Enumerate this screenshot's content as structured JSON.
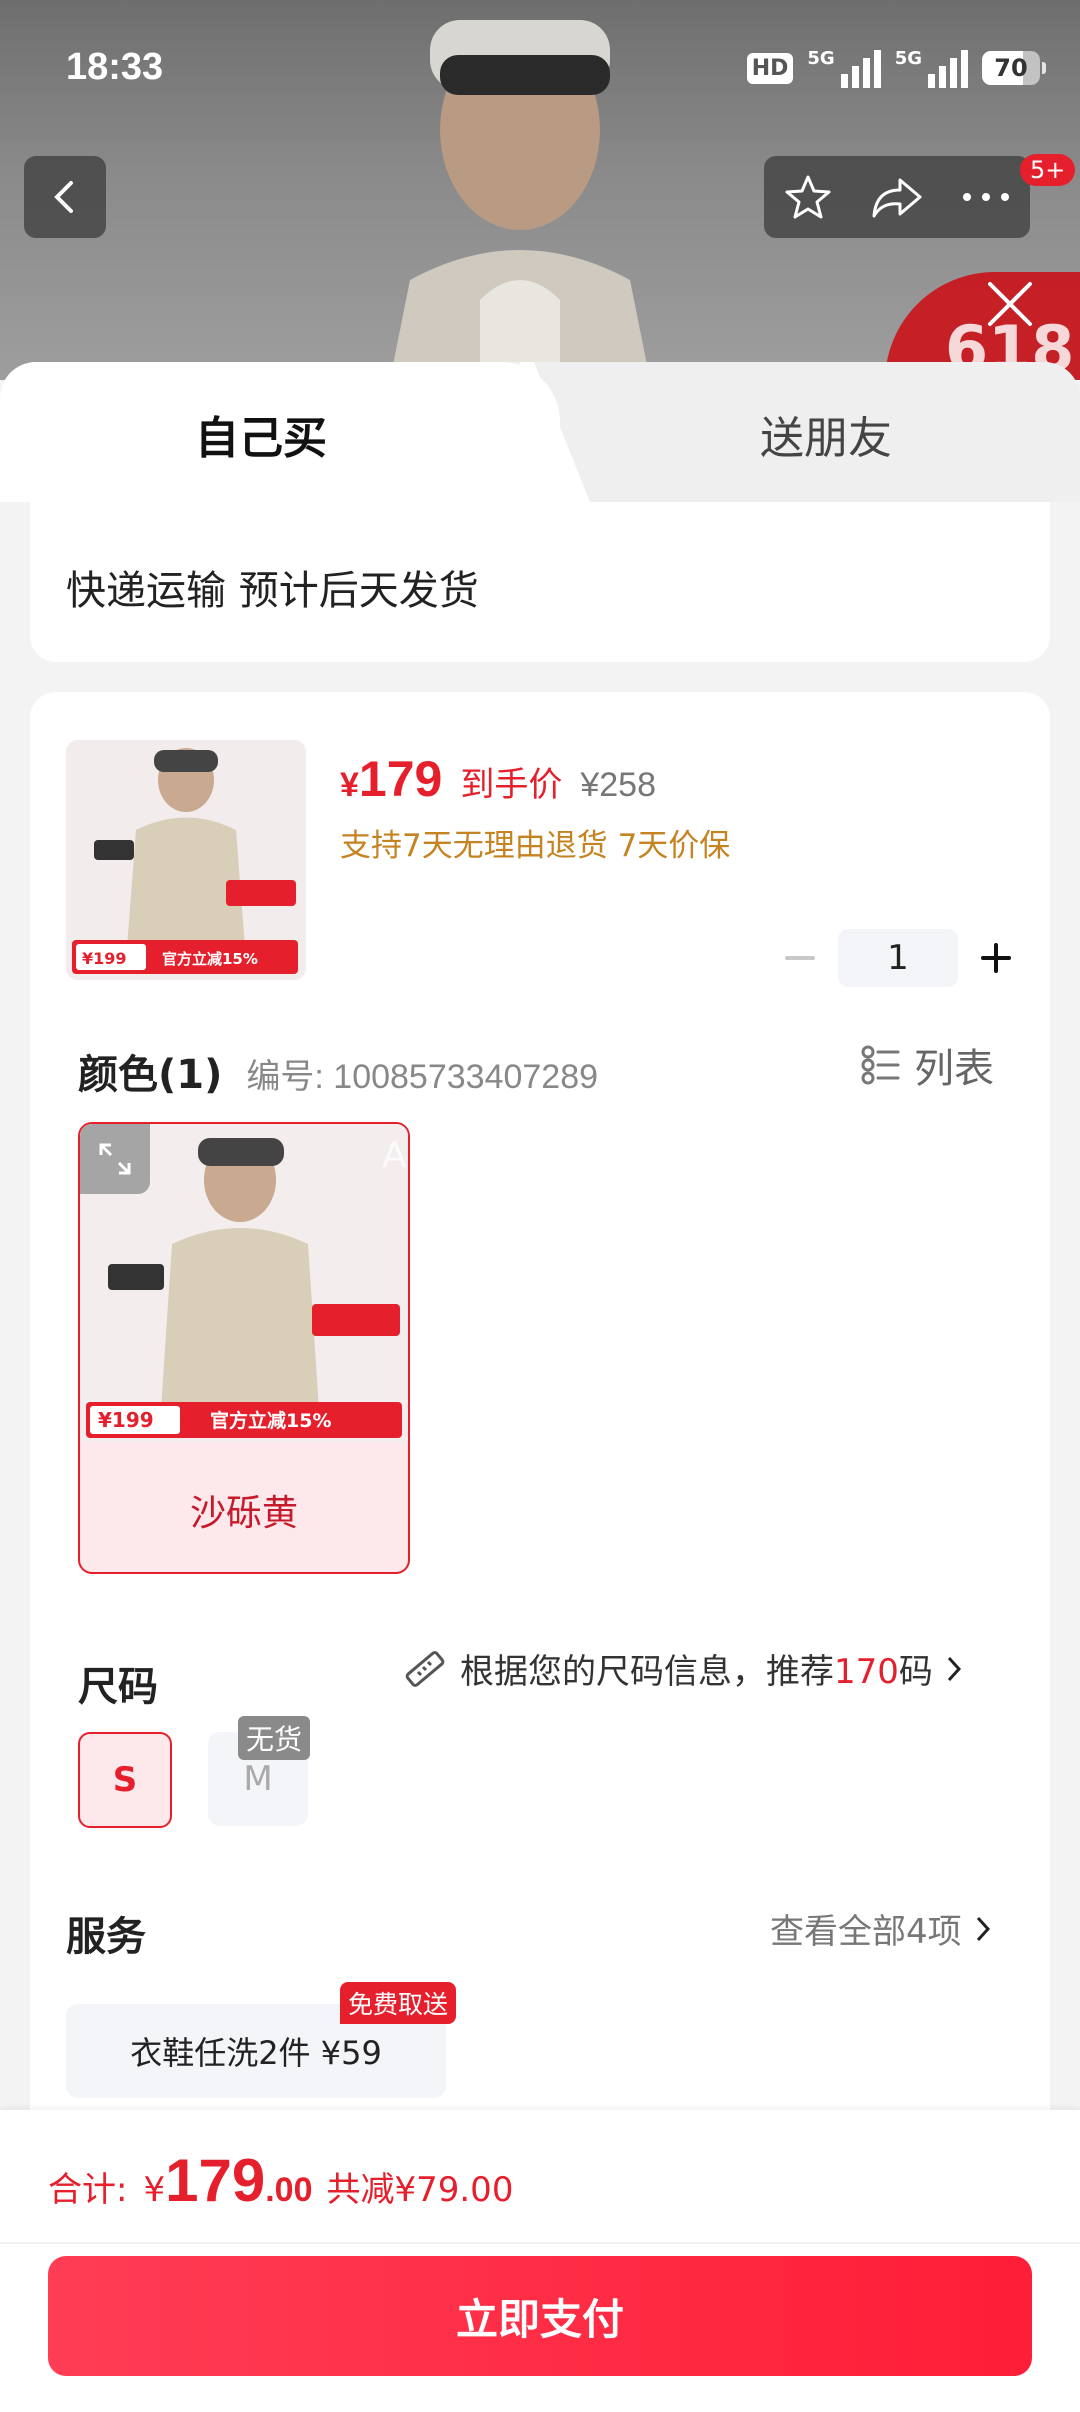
{
  "status_bar": {
    "time": "18:33",
    "hd": "HD",
    "signal_label": "5G",
    "battery": "70"
  },
  "top_bar": {
    "notification_count": "5+",
    "promo_badge": "618"
  },
  "tabs": [
    {
      "label": "自己买"
    },
    {
      "label": "送朋友"
    }
  ],
  "delivery": {
    "text": "快递运输 预计后天发货"
  },
  "product": {
    "price": "179",
    "currency": "¥",
    "price_tag": "到手价",
    "original_price": "¥258",
    "policy": "支持7天无理由退货  7天价保",
    "quantity": "1",
    "thumb_promo": "官方立减15%",
    "thumb_price": "¥199"
  },
  "color": {
    "title": "颜色(1)",
    "code": "编号: 10085733407289",
    "list_label": "列表",
    "options": [
      {
        "label": "沙砾黄"
      }
    ],
    "watermark": "ABC好好学习"
  },
  "size": {
    "title": "尺码",
    "reco_prefix": "根据您的尺码信息，推荐",
    "reco_value": "170",
    "reco_suffix": "码",
    "options": [
      {
        "label": "S"
      },
      {
        "label": "M",
        "tag": "无货"
      }
    ]
  },
  "service": {
    "title": "服务",
    "more": "查看全部4项",
    "items": [
      {
        "label": "衣鞋任洗2件  ¥59",
        "badge": "免费取送"
      }
    ]
  },
  "footer": {
    "total_label": "合计:",
    "currency": "¥",
    "total_int": "179",
    "total_dec": ".00",
    "saving": "共减¥79.00",
    "pay_button": "立即支付"
  },
  "colors": {
    "accent": "#e5202c",
    "policy": "#c58321"
  }
}
